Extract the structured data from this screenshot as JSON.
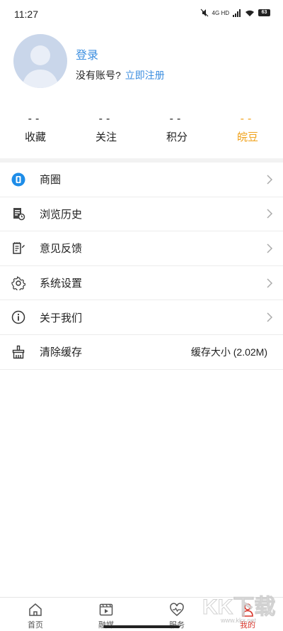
{
  "status_bar": {
    "time": "11:27",
    "network": "4G HD",
    "battery": "63"
  },
  "profile": {
    "login_label": "登录",
    "no_account_text": "没有账号?",
    "register_label": "立即注册"
  },
  "stats": [
    {
      "value": "--",
      "label": "收藏"
    },
    {
      "value": "--",
      "label": "关注"
    },
    {
      "value": "--",
      "label": "积分"
    },
    {
      "value": "--",
      "label": "皖豆"
    }
  ],
  "menu": [
    {
      "label": "商圈",
      "icon": "shop-circle-icon"
    },
    {
      "label": "浏览历史",
      "icon": "history-icon"
    },
    {
      "label": "意见反馈",
      "icon": "feedback-icon"
    },
    {
      "label": "系统设置",
      "icon": "gear-icon"
    },
    {
      "label": "关于我们",
      "icon": "info-icon"
    },
    {
      "label": "清除缓存",
      "icon": "broom-icon",
      "value": "缓存大小 (2.02M)"
    }
  ],
  "tabs": [
    {
      "label": "首页",
      "icon": "home-icon"
    },
    {
      "label": "融媒",
      "icon": "media-icon"
    },
    {
      "label": "服务",
      "icon": "service-heart-icon"
    },
    {
      "label": "我的",
      "icon": "user-icon",
      "active": true
    }
  ],
  "watermark": {
    "text": "KK下载",
    "url": "www.kkx.net"
  },
  "colors": {
    "link": "#3d8fe0",
    "gold": "#f0a21b",
    "active_tab": "#d8352a"
  }
}
